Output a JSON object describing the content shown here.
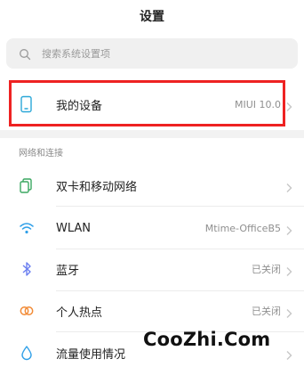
{
  "header": {
    "title": "设置"
  },
  "search": {
    "placeholder": "搜索系统设置项"
  },
  "device": {
    "label": "我的设备",
    "value": "MIUI 10.0"
  },
  "network_section": {
    "title": "网络和连接",
    "items": [
      {
        "label": "双卡和移动网络",
        "value": "",
        "icon": "dual-sim-icon",
        "icon_color": "#3aa760"
      },
      {
        "label": "WLAN",
        "value": "Mtime-OfficeB5",
        "icon": "wifi-icon",
        "icon_color": "#2f9fe8"
      },
      {
        "label": "蓝牙",
        "value": "已关闭",
        "icon": "bluetooth-icon",
        "icon_color": "#6b7ff0"
      },
      {
        "label": "个人热点",
        "value": "已关闭",
        "icon": "hotspot-icon",
        "icon_color": "#f28a35"
      },
      {
        "label": "流量使用情况",
        "value": "",
        "icon": "data-usage-icon",
        "icon_color": "#2f9fe8"
      }
    ]
  },
  "watermark": {
    "text": "CooZhi.Com"
  },
  "colors": {
    "highlight_border": "#ee2222",
    "device_icon": "#2aa7d8"
  }
}
